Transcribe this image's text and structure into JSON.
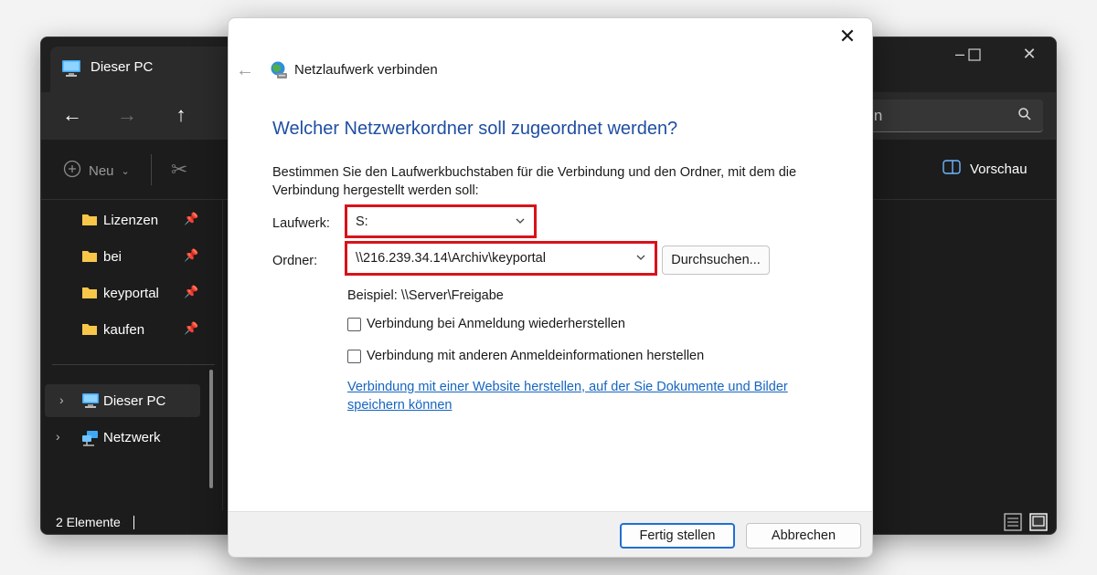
{
  "explorer": {
    "tab_title": "Dieser PC",
    "search_placeholder": "uchen",
    "cmd_new_label": "Neu",
    "cmd_preview_label": "Vorschau",
    "sidebar": [
      {
        "label": "Lizenzen",
        "pinned": true
      },
      {
        "label": "bei",
        "pinned": true
      },
      {
        "label": "keyportal",
        "pinned": true
      },
      {
        "label": "kaufen",
        "pinned": true
      }
    ],
    "tree": [
      {
        "label": "Dieser PC",
        "icon": "pc-icon",
        "selected": true
      },
      {
        "label": "Netzwerk",
        "icon": "network-icon",
        "selected": false
      }
    ],
    "status_text": "2 Elemente"
  },
  "dialog": {
    "title": "Netzlaufwerk verbinden",
    "heading": "Welcher Netzwerkordner soll zugeordnet werden?",
    "description": "Bestimmen Sie den Laufwerkbuchstaben für die Verbindung und den Ordner, mit dem die Verbindung hergestellt werden soll:",
    "drive_label": "Laufwerk:",
    "drive_value": "S:",
    "folder_label": "Ordner:",
    "folder_value": "\\\\216.239.34.14\\Archiv\\keyportal",
    "browse_label": "Durchsuchen...",
    "example": "Beispiel: \\\\Server\\Freigabe",
    "reconnect_label": "Verbindung bei Anmeldung wiederherstellen",
    "other_credentials_label": "Verbindung mit anderen Anmeldeinformationen herstellen",
    "website_link": "Verbindung mit einer Website herstellen, auf der Sie Dokumente und Bilder speichern können",
    "finish_label": "Fertig stellen",
    "cancel_label": "Abbrechen",
    "highlight_color": "#d8121b",
    "heading_color": "#1f4ea1",
    "link_color": "#1565c0"
  }
}
